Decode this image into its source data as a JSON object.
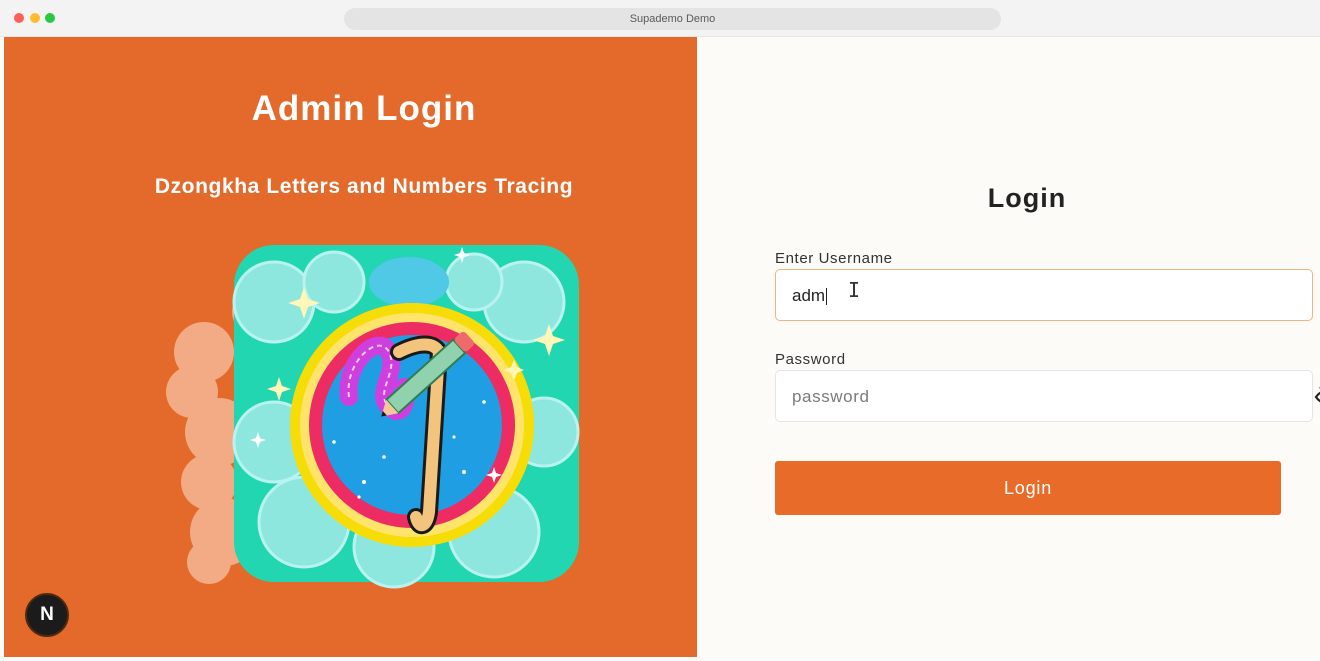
{
  "window": {
    "title": "Supademo Demo"
  },
  "left_panel": {
    "title": "Admin Login",
    "subtitle": "Dzongkha Letters and Numbers Tracing",
    "badge": "N",
    "accent_color": "#e36a2a"
  },
  "login_form": {
    "title": "Login",
    "username_label": "Enter Username",
    "username_value": "adm",
    "password_label": "Password",
    "password_placeholder": "password",
    "toggle_icon": "eye-slash-icon",
    "submit_label": "Login",
    "button_color": "#e86b29"
  }
}
